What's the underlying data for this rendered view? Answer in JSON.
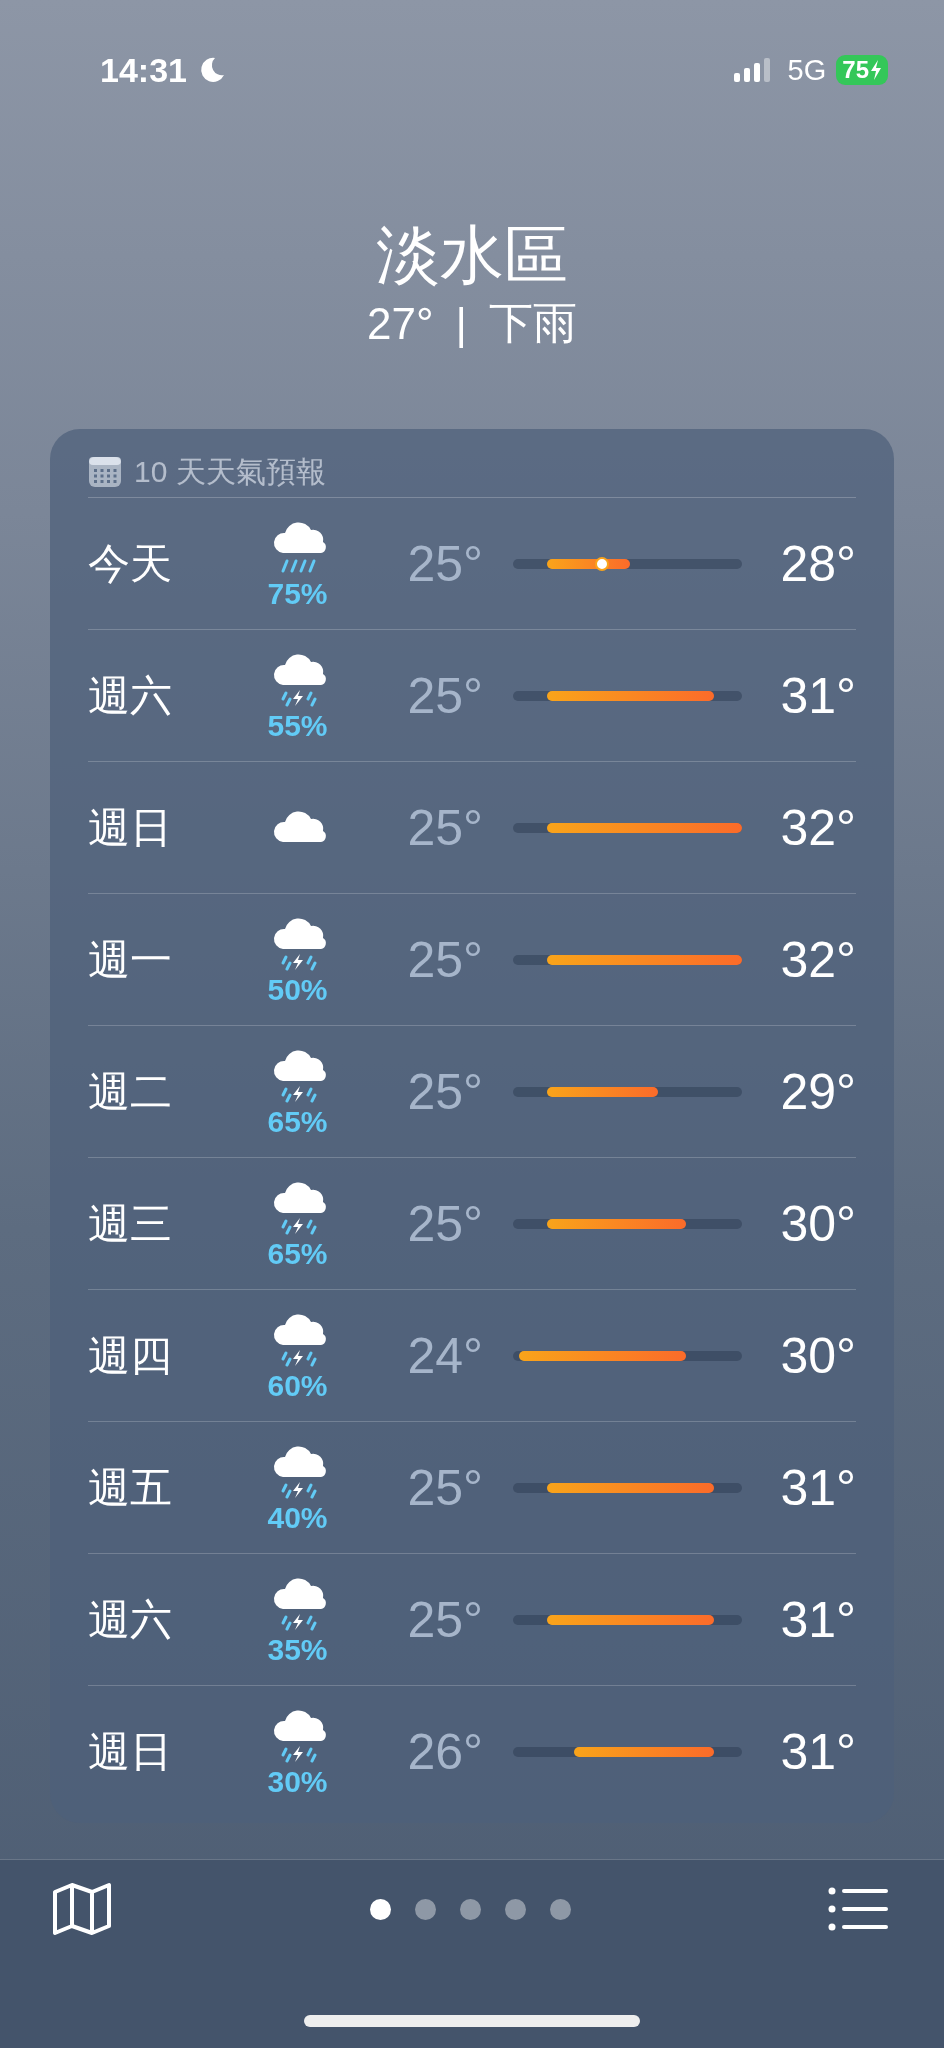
{
  "status_bar": {
    "time": "14:31",
    "network": "5G",
    "battery": "75",
    "charging": true,
    "focus_moon": true
  },
  "header": {
    "location": "淡水區",
    "temperature": "27°",
    "separator": "|",
    "condition": "下雨"
  },
  "forecast": {
    "title": "10 天天氣預報",
    "days": [
      {
        "day": "今天",
        "kind": "rain",
        "chance": "75%",
        "low": "25°",
        "high": "28°",
        "current_marker": true
      },
      {
        "day": "週六",
        "kind": "thunderstorm",
        "chance": "55%",
        "low": "25°",
        "high": "31°",
        "current_marker": false
      },
      {
        "day": "週日",
        "kind": "cloudy",
        "low": "25°",
        "high": "32°",
        "current_marker": false
      },
      {
        "day": "週一",
        "kind": "thunderstorm",
        "chance": "50%",
        "low": "25°",
        "high": "32°",
        "current_marker": false
      },
      {
        "day": "週二",
        "kind": "thunderstorm",
        "chance": "65%",
        "low": "25°",
        "high": "29°",
        "current_marker": false
      },
      {
        "day": "週三",
        "kind": "thunderstorm",
        "chance": "65%",
        "low": "25°",
        "high": "30°",
        "current_marker": false
      },
      {
        "day": "週四",
        "kind": "thunderstorm",
        "chance": "60%",
        "low": "24°",
        "high": "30°",
        "current_marker": false
      },
      {
        "day": "週五",
        "kind": "thunderstorm",
        "chance": "40%",
        "low": "25°",
        "high": "31°",
        "current_marker": false
      },
      {
        "day": "週六",
        "kind": "thunderstorm",
        "chance": "35%",
        "low": "25°",
        "high": "31°",
        "current_marker": false
      },
      {
        "day": "週日",
        "kind": "thunderstorm",
        "chance": "30%",
        "low": "26°",
        "high": "31°",
        "current_marker": false
      }
    ]
  },
  "page_dots": [
    {
      "selected": true
    },
    {
      "selected": false
    },
    {
      "selected": false
    },
    {
      "selected": false
    },
    {
      "selected": false
    }
  ]
}
